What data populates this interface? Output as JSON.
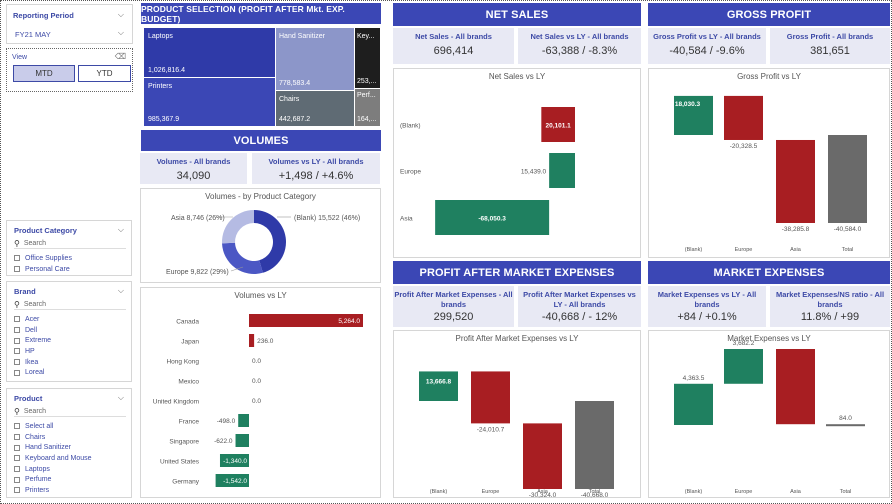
{
  "filters": {
    "reporting_period": {
      "title": "Reporting Period",
      "value": "FY21 MAY"
    },
    "view": {
      "title": "View",
      "options": [
        "MTD",
        "YTD"
      ],
      "selected": "MTD"
    },
    "product_category": {
      "title": "Product Category",
      "search": "Search",
      "items": [
        "Office Supplies",
        "Personal Care"
      ]
    },
    "brand": {
      "title": "Brand",
      "search": "Search",
      "items": [
        "Acer",
        "Dell",
        "Extreme",
        "HP",
        "Ikea",
        "Loreal"
      ]
    },
    "product": {
      "title": "Product",
      "search": "Search",
      "items": [
        "Select all",
        "Chairs",
        "Hand Sanitizer",
        "Keyboard and Mouse",
        "Laptops",
        "Perfume",
        "Printers"
      ]
    }
  },
  "product_selection": {
    "title": "PRODUCT SELECTION (PROFIT AFTER Mkt. EXP. BUDGET)",
    "tiles": [
      {
        "name": "Laptops",
        "value": "1,026,816.4",
        "color": "#2f3aa8"
      },
      {
        "name": "Printers",
        "value": "985,367.9",
        "color": "#3b47b5"
      },
      {
        "name": "Hand Sanitizer",
        "value": "778,583.4",
        "color": "#8c96c9"
      },
      {
        "name": "Chairs",
        "value": "442,687.2",
        "color": "#5f6b74"
      },
      {
        "name": "Key...",
        "value": "253,...",
        "color": "#1e1e1e"
      },
      {
        "name": "Perf...",
        "value": "164,...",
        "color": "#7d7d7d"
      }
    ]
  },
  "volumes": {
    "title": "VOLUMES",
    "kpis": [
      {
        "label": "Volumes - All brands",
        "value": "34,090"
      },
      {
        "label": "Volumes vs LY - All brands",
        "value": "+1,498 / +4.6%"
      }
    ],
    "donut_title": "Volumes - by Product Category",
    "donut_labels": [
      "Asia 8,746 (26%)",
      "(Blank) 15,522 (46%)",
      "Europe 9,822 (29%)"
    ],
    "bar_title": "Volumes vs LY"
  },
  "net_sales": {
    "title": "NET SALES",
    "kpis": [
      {
        "label": "Net Sales - All brands",
        "value": "696,414"
      },
      {
        "label": "Net Sales vs LY - All brands",
        "value": "-63,388 / -8.3%"
      }
    ],
    "chart_title": "Net Sales vs LY"
  },
  "gross_profit": {
    "title": "GROSS PROFIT",
    "kpis": [
      {
        "label": "Gross Profit vs LY - All brands",
        "value": "-40,584 / -9.6%"
      },
      {
        "label": "Gross Profit - All brands",
        "value": "381,651"
      }
    ],
    "chart_title": "Gross Profit vs LY"
  },
  "profit_after_market": {
    "title": "PROFIT AFTER MARKET EXPENSES",
    "kpis": [
      {
        "label": "Profit After Market Expenses - All brands",
        "value": "299,520"
      },
      {
        "label": "Profit After Market Expenses vs LY - All brands",
        "value": "-40,668 / - 12%"
      }
    ],
    "chart_title": "Profit After Market Expenses vs LY"
  },
  "market_expenses": {
    "title": "MARKET EXPENSES",
    "kpis": [
      {
        "label": "Market Expenses vs LY - All brands",
        "value": "+84 / +0.1%"
      },
      {
        "label": "Market Expenses/NS ratio - All brands",
        "value": "11.8% / +99"
      }
    ],
    "chart_title": "Market Expenses vs LY"
  },
  "chart_data": [
    {
      "type": "bar",
      "title": "Volumes vs LY",
      "orientation": "horizontal",
      "categories": [
        "Canada",
        "Japan",
        "Hong Kong",
        "Mexico",
        "United Kingdom",
        "France",
        "Singapore",
        "United States",
        "Germany"
      ],
      "values": [
        5264.0,
        236.0,
        0.0,
        0.0,
        0.0,
        -498.0,
        -622.0,
        -1340.0,
        -1542.0
      ],
      "labels": [
        "5,264.0",
        "236.0",
        "0.0",
        "0.0",
        "0.0",
        "-498.0",
        "-622.0",
        "-1,340.0",
        "-1,542.0"
      ],
      "colors": {
        "positive": "#a81e22",
        "negative": "#1f8060"
      }
    },
    {
      "type": "bar",
      "title": "Net Sales vs LY",
      "orientation": "horizontal",
      "categories": [
        "(Blank)",
        "Europe",
        "Asia"
      ],
      "values": [
        20101.1,
        -15439.0,
        -68050.3
      ],
      "labels": [
        "20,101.1",
        "15,439.0",
        "-68,050.3"
      ],
      "colors": {
        "positive": "#a81e22",
        "negative": "#1f8060"
      }
    },
    {
      "type": "bar",
      "title": "Gross Profit vs LY",
      "waterfall": true,
      "categories": [
        "(Blank)",
        "Europe",
        "Asia",
        "Total"
      ],
      "values": [
        18030.3,
        -20328.5,
        -38285.8,
        -40584.0
      ],
      "labels": [
        "18,030.3",
        "-20,328.5",
        "-38,285.8",
        "-40,584.0"
      ]
    },
    {
      "type": "bar",
      "title": "Profit After Market Expenses vs LY",
      "waterfall": true,
      "categories": [
        "(Blank)",
        "Europe",
        "Asia",
        "Total"
      ],
      "values": [
        13666.8,
        -24010.7,
        -30324.0,
        -40668.0
      ],
      "labels": [
        "13,666.8",
        "-24,010.7",
        "-30,324.0",
        "-40,668.0"
      ]
    },
    {
      "type": "bar",
      "title": "Market Expenses vs LY",
      "waterfall": true,
      "categories": [
        "(Blank)",
        "Europe",
        "Asia",
        "Total"
      ],
      "values": [
        4363.5,
        3682.2,
        -7961.8,
        84.0
      ],
      "labels": [
        "4,363.5",
        "3,682.2",
        "-7,961.8",
        "84.0"
      ]
    },
    {
      "type": "pie",
      "title": "Volumes - by Product Category",
      "donut": true,
      "categories": [
        "(Blank)",
        "Europe",
        "Asia"
      ],
      "values": [
        15522,
        9822,
        8746
      ],
      "colors": [
        "#2f3aa8",
        "#4b57c4",
        "#b5bbe3"
      ]
    }
  ]
}
